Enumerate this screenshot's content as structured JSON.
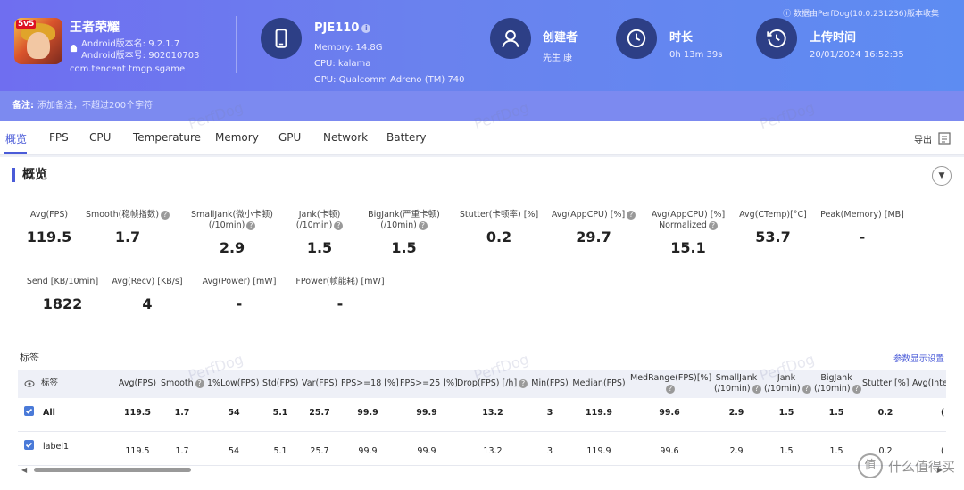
{
  "app": {
    "name": "王者荣耀",
    "version_name": "Android版本名: 9.2.1.7",
    "version_code": "Android版本号: 902010703",
    "package": "com.tencent.tmgp.sgame",
    "icon_badge": "5v5"
  },
  "device": {
    "model": "PJE110",
    "memory": "Memory: 14.8G",
    "cpu": "CPU: kalama",
    "gpu": "GPU: Qualcomm Adreno (TM) 740"
  },
  "creator": {
    "title": "创建者",
    "value": "先生 康"
  },
  "duration": {
    "title": "时长",
    "value": "0h 13m 39s"
  },
  "upload": {
    "title": "上传时间",
    "value": "20/01/2024 16:52:35"
  },
  "version_note": "数据由PerfDog(10.0.231236)版本收集",
  "note": {
    "label": "备注:",
    "placeholder": "添加备注，不超过200个字符"
  },
  "tabs": [
    "概览",
    "FPS",
    "CPU",
    "Temperature",
    "Memory",
    "GPU",
    "Network",
    "Battery"
  ],
  "export_label": "导出",
  "overview_title": "概览",
  "metrics_row1": [
    {
      "label1": "",
      "label2": "Avg(FPS)",
      "help": false,
      "value": "119.5"
    },
    {
      "label1": "",
      "label2": "Smooth(稳帧指数)",
      "help": true,
      "value": "1.7"
    },
    {
      "label1": "SmallJank(微小卡顿)",
      "label2": "(/10min)",
      "help": true,
      "value": "2.9"
    },
    {
      "label1": "Jank(卡顿)",
      "label2": "(/10min)",
      "help": true,
      "value": "1.5"
    },
    {
      "label1": "BigJank(严重卡顿)",
      "label2": "(/10min)",
      "help": true,
      "value": "1.5"
    },
    {
      "label1": "",
      "label2": "Stutter(卡顿率) [%]",
      "help": false,
      "value": "0.2"
    },
    {
      "label1": "",
      "label2": "Avg(AppCPU) [%]",
      "help": true,
      "value": "29.7"
    },
    {
      "label1": "Avg(AppCPU) [%]",
      "label2": "Normalized",
      "help": true,
      "value": "15.1"
    },
    {
      "label1": "",
      "label2": "Avg(CTemp)[°C]",
      "help": false,
      "value": "53.7"
    },
    {
      "label1": "",
      "label2": "Peak(Memory) [MB]",
      "help": false,
      "value": "-"
    }
  ],
  "metrics_row2": [
    {
      "label": "Send [KB/10min]",
      "value": "1822"
    },
    {
      "label": "Avg(Recv) [KB/s]",
      "value": "4"
    },
    {
      "label": "Avg(Power) [mW]",
      "value": "-"
    },
    {
      "label": "FPower(帧能耗) [mW]",
      "value": "-"
    }
  ],
  "tags_label": "标签",
  "params_link": "参数显示设置",
  "table": {
    "tag_header": "标签",
    "columns": [
      {
        "l1": "",
        "l2": "Avg(FPS)",
        "help": false
      },
      {
        "l1": "",
        "l2": "Smooth",
        "help": true
      },
      {
        "l1": "",
        "l2": "1%Low(FPS)",
        "help": false
      },
      {
        "l1": "",
        "l2": "Std(FPS)",
        "help": false
      },
      {
        "l1": "",
        "l2": "Var(FPS)",
        "help": false
      },
      {
        "l1": "",
        "l2": "FPS>=18 [%]",
        "help": false
      },
      {
        "l1": "",
        "l2": "FPS>=25 [%]",
        "help": false
      },
      {
        "l1": "",
        "l2": "Drop(FPS) [/h]",
        "help": true
      },
      {
        "l1": "",
        "l2": "Min(FPS)",
        "help": false
      },
      {
        "l1": "",
        "l2": "Median(FPS)",
        "help": false
      },
      {
        "l1": "",
        "l2": "MedRange(FPS)[%]",
        "help": true
      },
      {
        "l1": "SmallJank",
        "l2": "(/10min)",
        "help": true
      },
      {
        "l1": "Jank",
        "l2": "(/10min)",
        "help": true
      },
      {
        "l1": "BigJank",
        "l2": "(/10min)",
        "help": true
      },
      {
        "l1": "",
        "l2": "Stutter [%]",
        "help": false
      },
      {
        "l1": "",
        "l2": "Avg(Inte",
        "help": false
      }
    ],
    "rows": [
      {
        "name": "All",
        "values": [
          "119.5",
          "1.7",
          "54",
          "5.1",
          "25.7",
          "99.9",
          "99.9",
          "13.2",
          "3",
          "119.9",
          "99.6",
          "2.9",
          "1.5",
          "1.5",
          "0.2",
          "("
        ]
      },
      {
        "name": "label1",
        "values": [
          "119.5",
          "1.7",
          "54",
          "5.1",
          "25.7",
          "99.9",
          "99.9",
          "13.2",
          "3",
          "119.9",
          "99.6",
          "2.9",
          "1.5",
          "1.5",
          "0.2",
          "("
        ]
      }
    ]
  },
  "watermark": "PerfDog",
  "site_logo": {
    "mark": "值",
    "text": "什么值得买"
  }
}
